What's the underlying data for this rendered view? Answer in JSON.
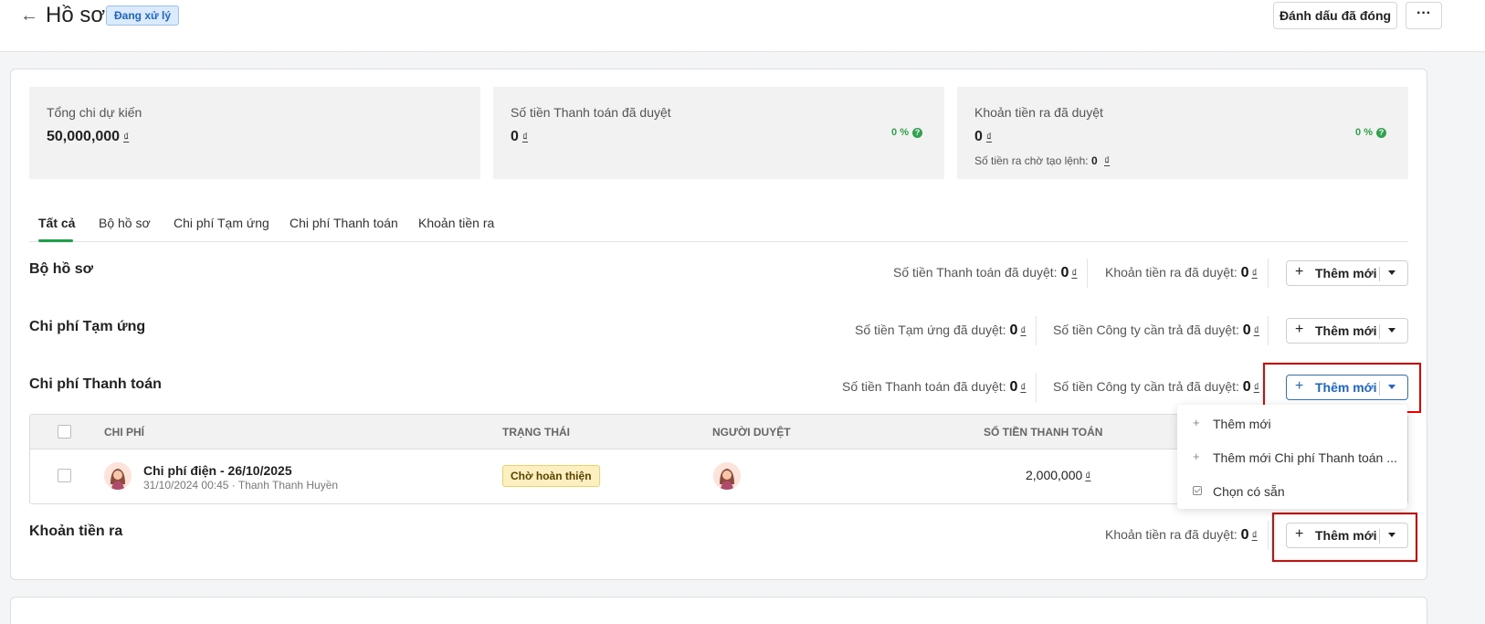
{
  "header": {
    "back_icon": "arrow-left-icon",
    "title": "Hồ sơ",
    "status": "Đang xử lý",
    "mark_closed_button": "Đánh dấu đã đóng",
    "more_icon": "more-horizontal-icon"
  },
  "stats": [
    {
      "label": "Tổng chi dự kiến",
      "value": "50,000,000",
      "currency": "₫"
    },
    {
      "label": "Số tiền Thanh toán đã duyệt",
      "value": "0",
      "currency": "₫",
      "percent": "0 %"
    },
    {
      "label": "Khoản tiền ra đã duyệt",
      "value": "0",
      "currency": "₫",
      "percent": "0 %",
      "sub_label": "Số tiền ra chờ tạo lệnh:",
      "sub_value": "0",
      "sub_currency": "₫"
    }
  ],
  "tabs": [
    "Tất cả",
    "Bộ hồ sơ",
    "Chi phí Tạm ứng",
    "Chi phí Thanh toán",
    "Khoản tiền ra"
  ],
  "add_button_label": "Thêm mới",
  "sections": {
    "bo_ho_so": {
      "title": "Bộ hồ sơ",
      "metrics": [
        {
          "label": "Số tiền Thanh toán đã duyệt:",
          "value": "0",
          "currency": "₫"
        },
        {
          "label": "Khoản tiền ra đã duyệt:",
          "value": "0",
          "currency": "₫"
        }
      ]
    },
    "tam_ung": {
      "title": "Chi phí Tạm ứng",
      "metrics": [
        {
          "label": "Số tiền Tạm ứng đã duyệt:",
          "value": "0",
          "currency": "₫"
        },
        {
          "label": "Số tiền Công ty cần trả đã duyệt:",
          "value": "0",
          "currency": "₫"
        }
      ]
    },
    "thanh_toan": {
      "title": "Chi phí Thanh toán",
      "metrics": [
        {
          "label": "Số tiền Thanh toán đã duyệt:",
          "value": "0",
          "currency": "₫"
        },
        {
          "label": "Số tiền Công ty cần trả đã duyệt:",
          "value": "0",
          "currency": "₫"
        }
      ],
      "table": {
        "headers": [
          "CHI PHÍ",
          "TRẠNG THÁI",
          "NGƯỜI DUYỆT",
          "SỐ TIỀN THANH TOÁN"
        ],
        "rows": [
          {
            "title": "Chi phí điện - 26/10/2025",
            "subtitle": "31/10/2024 00:45 · Thanh Thanh Huyền",
            "status": "Chờ hoàn thiện",
            "amount": "2,000,000",
            "currency": "₫"
          }
        ]
      }
    },
    "khoan_tien_ra": {
      "title": "Khoản tiền ra",
      "metrics": [
        {
          "label": "Khoản tiền ra đã duyệt:",
          "value": "0",
          "currency": "₫"
        }
      ]
    }
  },
  "dropdown": {
    "items": [
      {
        "icon": "plus-icon",
        "label": "Thêm mới"
      },
      {
        "icon": "plus-icon",
        "label": "Thêm mới Chi phí Thanh toán ..."
      },
      {
        "icon": "check-square-icon",
        "label": "Chọn có sẵn"
      }
    ]
  },
  "colors": {
    "accent_green": "#1aa14a",
    "accent_blue": "#1a64d6",
    "highlight_red": "#e00000"
  }
}
